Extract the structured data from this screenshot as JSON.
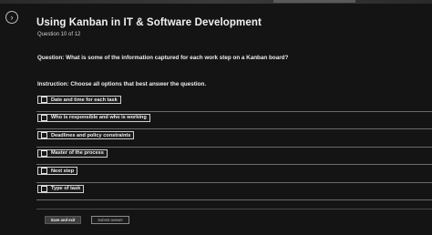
{
  "header": {
    "title": "Using Kanban in IT & Software Development",
    "question_number": "Question 10 of 12",
    "nav_icon": "chevron-right-icon"
  },
  "question": {
    "text": "Question: What is some of the information captured for each work step on a Kanban board?",
    "instruction": "Instruction: Choose all options that best answer the question."
  },
  "options": [
    {
      "label": "Date and time for each task",
      "checked": false
    },
    {
      "label": "Who is responsible and who is working",
      "checked": false
    },
    {
      "label": "Deadlines and policy constraints",
      "checked": false
    },
    {
      "label": "Master of the process",
      "checked": false
    },
    {
      "label": "Next step",
      "checked": false
    },
    {
      "label": "Type of task",
      "checked": false
    }
  ],
  "buttons": {
    "save_label": "Save and exit",
    "submit_label": "Submit answer"
  }
}
